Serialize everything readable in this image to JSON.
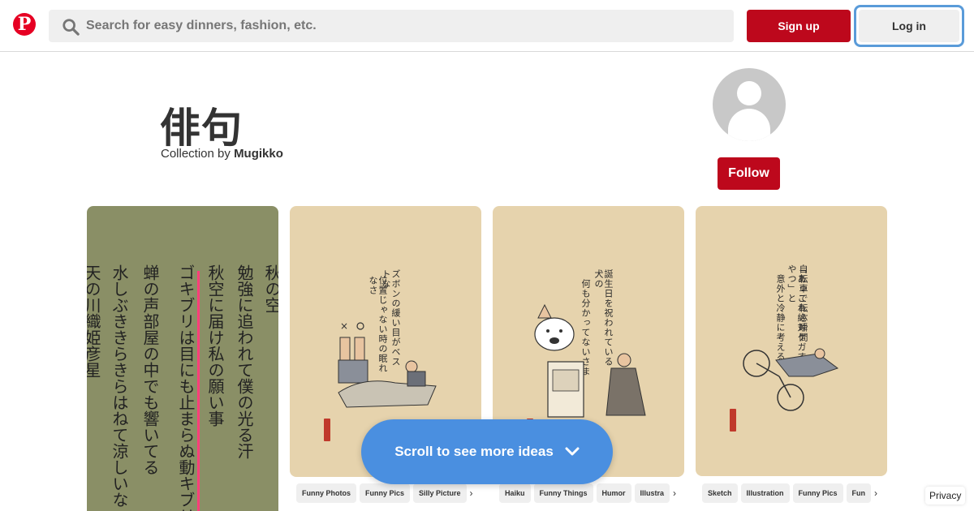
{
  "header": {
    "logo_icon": "pinterest-logo-icon",
    "search": {
      "placeholder": "Search for easy dinners, fashion, etc.",
      "value": "",
      "icon": "search-icon"
    },
    "signup_label": "Sign up",
    "login_label": "Log in",
    "brand_color": "#bd081c",
    "login_focus_color": "#5a9bd9"
  },
  "collection": {
    "title": "俳句",
    "byline_prefix": "Collection by",
    "author": "Mugikko",
    "avatar_icon": "default-avatar-icon",
    "follow_label": "Follow"
  },
  "pins": [
    {
      "image": "book-page-photo",
      "book_columns": [
        "秋の空",
        "勉強に追われて僕の光る汗",
        "秋空に届け私の願い事",
        "ゴキブリは目にも止まらぬ動キブリ",
        "蝉の声部屋の中でも響いてる",
        "水しぶききらきらはねて涼しいな",
        "天の川織姫彦星"
      ],
      "tags": [],
      "more": ""
    },
    {
      "image": "haiku-illustration-sleeping",
      "caption": [
        "ズボンの緩い目がベストな",
        "位置じゃない時の眠れなさ"
      ],
      "tags": [
        "Funny Photos",
        "Funny Pics",
        "Silly Picture"
      ],
      "more": "›"
    },
    {
      "image": "haiku-illustration-dog",
      "caption": [
        "誕生日を祝われている犬の",
        "何も分かってないさま"
      ],
      "tags": [
        "Haiku",
        "Funny Things",
        "Humor",
        "Illustra"
      ],
      "more": "›"
    },
    {
      "image": "haiku-illustration-bicycle",
      "caption": [
        "自転車で転ぶ瞬間",
        "「あっこれ絶対ケガするやつ」と",
        "意外と冷静に考える"
      ],
      "tags": [
        "Sketch",
        "Illustration",
        "Funny Pics",
        "Fun"
      ],
      "more": "›"
    }
  ],
  "scroll_prompt": {
    "label": "Scroll to see more ideas",
    "icon": "chevron-down-icon",
    "color": "#4a8fe0"
  },
  "privacy_label": "Privacy"
}
